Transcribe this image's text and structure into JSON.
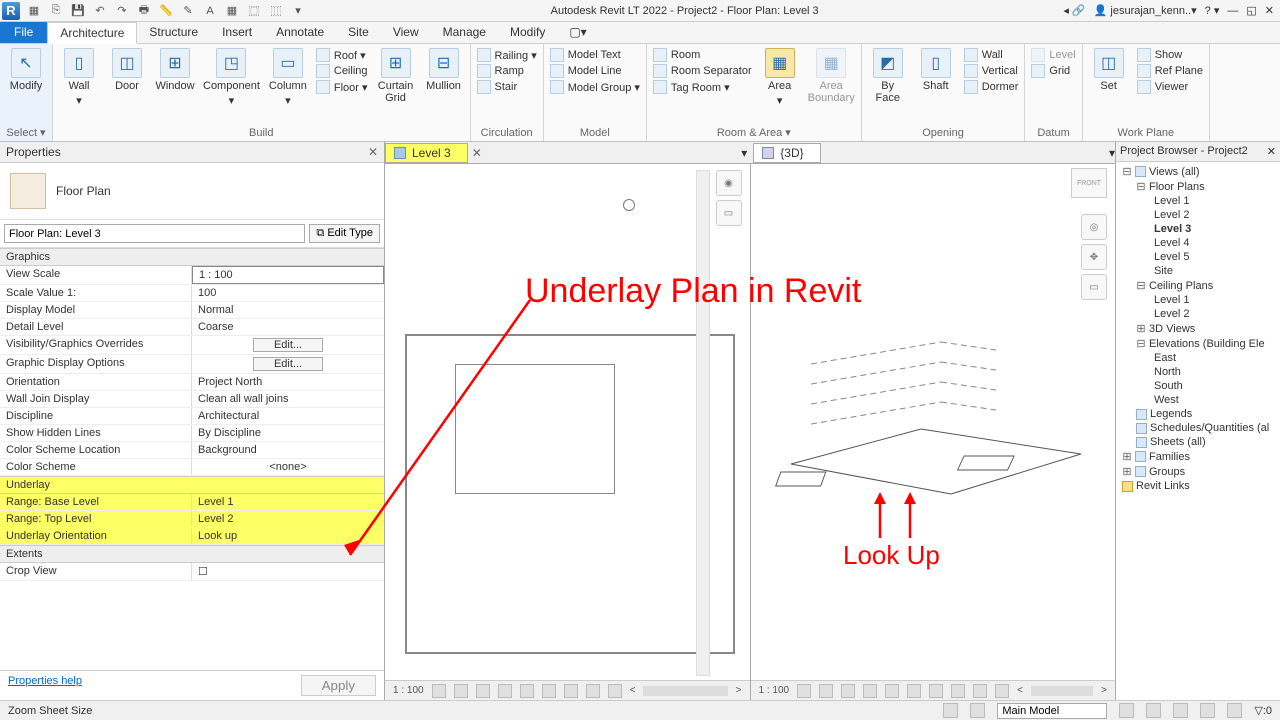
{
  "titlebar": {
    "app": "Autodesk Revit LT 2022 - Project2 - Floor Plan: Level 3",
    "user": "jesurajan_kenn..",
    "logo": "R"
  },
  "menu": {
    "file": "File",
    "tabs": [
      "Architecture",
      "Structure",
      "Insert",
      "Annotate",
      "Site",
      "View",
      "Manage",
      "Modify"
    ]
  },
  "ribbon": {
    "select": {
      "modify": "Modify",
      "label": "Select ▾"
    },
    "build": {
      "wall": "Wall",
      "door": "Door",
      "window": "Window",
      "component": "Component",
      "column": "Column",
      "roof": "Roof ▾",
      "ceiling": "Ceiling",
      "floor": "Floor ▾",
      "curtain": "Curtain\nGrid",
      "mullion": "Mullion",
      "label": "Build"
    },
    "circ": {
      "railing": "Railing ▾",
      "ramp": "Ramp",
      "stair": "Stair",
      "label": "Circulation"
    },
    "model": {
      "text": "Model Text",
      "line": "Model Line",
      "group": "Model Group ▾",
      "label": "Model"
    },
    "room": {
      "room": "Room",
      "sep": "Room Separator",
      "tag": "Tag Room ▾",
      "area": "Area",
      "areab": "Area\nBoundary",
      "label": "Room & Area ▾"
    },
    "open": {
      "byface": "By\nFace",
      "shaft": "Shaft",
      "wall": "Wall",
      "vert": "Vertical",
      "dormer": "Dormer",
      "label": "Opening"
    },
    "datum": {
      "level": "Level",
      "grid": "Grid",
      "label": "Datum"
    },
    "wp": {
      "set": "Set",
      "show": "Show",
      "ref": "Ref Plane",
      "viewer": "Viewer",
      "label": "Work Plane"
    }
  },
  "props": {
    "title": "Properties",
    "type": "Floor Plan",
    "instance": "Floor Plan: Level 3",
    "edit_type": "Edit Type",
    "sections": {
      "graphics": "Graphics",
      "underlay": "Underlay",
      "extents": "Extents"
    },
    "rows": {
      "view_scale": {
        "k": "View Scale",
        "v": "1 : 100"
      },
      "scale_value": {
        "k": "Scale Value    1:",
        "v": "100"
      },
      "display_model": {
        "k": "Display Model",
        "v": "Normal"
      },
      "detail": {
        "k": "Detail Level",
        "v": "Coarse"
      },
      "vg": {
        "k": "Visibility/Graphics Overrides",
        "v": "Edit..."
      },
      "gdo": {
        "k": "Graphic Display Options",
        "v": "Edit..."
      },
      "orient": {
        "k": "Orientation",
        "v": "Project North"
      },
      "wjoin": {
        "k": "Wall Join Display",
        "v": "Clean all wall joins"
      },
      "disc": {
        "k": "Discipline",
        "v": "Architectural"
      },
      "hidden": {
        "k": "Show Hidden Lines",
        "v": "By Discipline"
      },
      "csl": {
        "k": "Color Scheme Location",
        "v": "Background"
      },
      "cs": {
        "k": "Color Scheme",
        "v": "<none>"
      },
      "base": {
        "k": "Range: Base Level",
        "v": "Level 1"
      },
      "top": {
        "k": "Range: Top Level",
        "v": "Level 2"
      },
      "uo": {
        "k": "Underlay Orientation",
        "v": "Look up"
      },
      "crop": {
        "k": "Crop View",
        "v": ""
      }
    },
    "help": "Properties help",
    "apply": "Apply"
  },
  "vtabs": {
    "level3": "Level 3",
    "threeD": "{3D}"
  },
  "viewbar": {
    "scale": "1 : 100"
  },
  "browser": {
    "title": "Project Browser - Project2",
    "views": "Views (all)",
    "fp": "Floor Plans",
    "levels": [
      "Level 1",
      "Level 2",
      "Level 3",
      "Level 4",
      "Level 5",
      "Site"
    ],
    "cp": "Ceiling Plans",
    "cpl": [
      "Level 1",
      "Level 2"
    ],
    "threeD": "3D Views",
    "elev": "Elevations (Building Ele",
    "elevs": [
      "East",
      "North",
      "South",
      "West"
    ],
    "legends": "Legends",
    "sched": "Schedules/Quantities (al",
    "sheets": "Sheets (all)",
    "fam": "Families",
    "groups": "Groups",
    "links": "Revit Links"
  },
  "status": {
    "left": "Zoom Sheet Size",
    "model": "Main Model"
  },
  "anno": {
    "title": "Underlay Plan in Revit",
    "look": "Look Up"
  }
}
